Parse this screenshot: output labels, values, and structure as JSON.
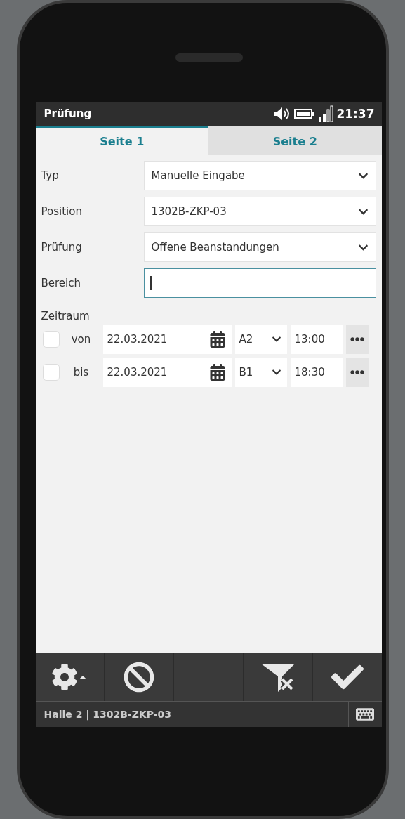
{
  "status_bar": {
    "title": "Prüfung",
    "time": "21:37"
  },
  "tabs": [
    {
      "label": "Seite 1",
      "selected": true
    },
    {
      "label": "Seite 2",
      "selected": false
    }
  ],
  "fields": [
    {
      "label": "Typ",
      "kind": "select",
      "value": "Manuelle Eingabe"
    },
    {
      "label": "Position",
      "kind": "select",
      "value": "1302B-ZKP-03"
    },
    {
      "label": "Prüfung",
      "kind": "select",
      "value": "Offene Beanstandungen"
    },
    {
      "label": "Bereich",
      "kind": "text",
      "focused": true
    }
  ],
  "period": {
    "label": "Zeitraum",
    "rows": [
      {
        "label": "von",
        "checked": false,
        "date": "22.03.2021",
        "shift": "A2",
        "time": "13:00"
      },
      {
        "label": "bis",
        "checked": false,
        "date": "22.03.2021",
        "shift": "B1",
        "time": "18:30"
      }
    ]
  },
  "toolbar": [
    {
      "kind": "settings"
    },
    {
      "kind": "cancel"
    },
    {
      "kind": "empty"
    },
    {
      "kind": "clear-filter"
    },
    {
      "kind": "confirm"
    }
  ],
  "footer": {
    "text": "Halle 2 | 1302B-ZKP-03"
  }
}
